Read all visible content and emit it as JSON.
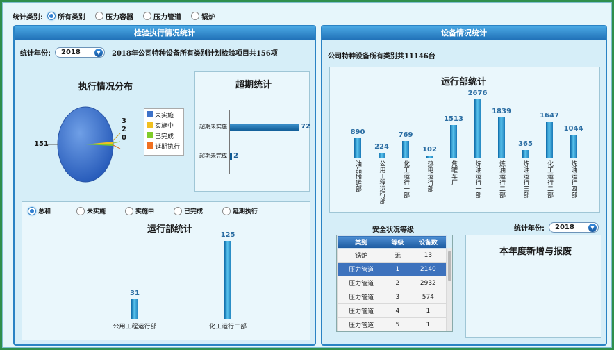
{
  "filter": {
    "label": "统计类别:",
    "options": [
      "所有类别",
      "压力容器",
      "压力管道",
      "锅炉"
    ],
    "selected": 0
  },
  "left_panel": {
    "header": "检验执行情况统计",
    "year_label": "统计年份:",
    "year": "2018",
    "summary": "2018年公司特种设备所有类别计划检验项目共156项",
    "pie": {
      "title": "执行情况分布",
      "labels": [
        "151",
        "3",
        "2",
        "0"
      ],
      "legend": [
        "未实施",
        "实施中",
        "已完成",
        "延期执行"
      ],
      "colors": [
        "#3d72c9",
        "#f0c020",
        "#7fcc2a",
        "#f07020"
      ]
    },
    "overdue": {
      "title": "超期统计",
      "rows": [
        {
          "label": "超期未实施",
          "value": "72"
        },
        {
          "label": "超期未完成",
          "value": "2"
        }
      ]
    },
    "dept": {
      "radios": [
        "总和",
        "未实施",
        "实施中",
        "已完成",
        "延期执行"
      ],
      "selected": 0,
      "title": "运行部统计",
      "chart_data": {
        "type": "bar",
        "categories": [
          "公用工程运行部",
          "化工运行二部"
        ],
        "values": [
          31,
          125
        ]
      }
    }
  },
  "right_panel": {
    "header": "设备情况统计",
    "summary": "公司特种设备所有类别共11146台",
    "dept": {
      "title": "运行部统计",
      "chart_data": {
        "type": "bar",
        "categories": [
          "油品储运部",
          "公用工程运行部",
          "化工运行一部",
          "热电运行部",
          "焦罐车厂",
          "炼油运行一部",
          "炼油运行二部",
          "炼油运行三部",
          "化工运行二部",
          "炼油运行四部"
        ],
        "values": [
          890,
          224,
          769,
          102,
          1513,
          2676,
          1839,
          365,
          1647,
          1044
        ]
      }
    },
    "safety": {
      "title": "安全状况等级",
      "columns": [
        "类别",
        "等级",
        "设备数"
      ],
      "rows": [
        [
          "锅炉",
          "无",
          "13"
        ],
        [
          "压力管道",
          "1",
          "2140"
        ],
        [
          "压力管道",
          "2",
          "2932"
        ],
        [
          "压力管道",
          "3",
          "574"
        ],
        [
          "压力管道",
          "4",
          "1"
        ],
        [
          "压力管道",
          "5",
          "1"
        ]
      ],
      "selected_row": 1
    },
    "year_label": "统计年份:",
    "year": "2018",
    "newscrap_title": "本年度新增与报废"
  }
}
